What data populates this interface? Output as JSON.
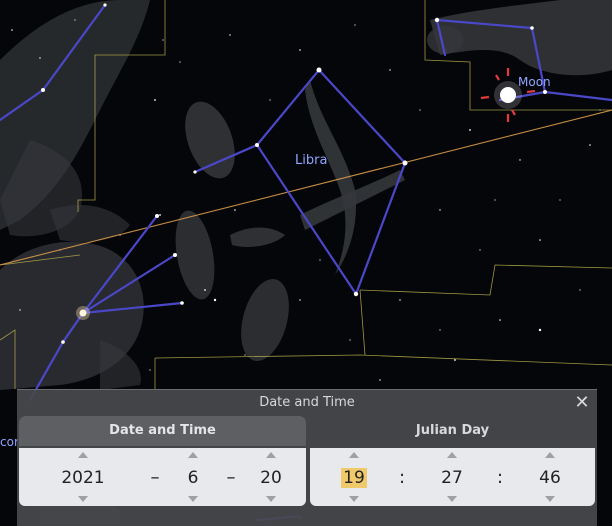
{
  "sky": {
    "constellation_label": "Libra",
    "moon_label": "Moon",
    "scorpius_label": "corpius"
  },
  "dialog": {
    "title": "Date and Time",
    "close_label": "✕",
    "tabs": {
      "date_label": "Date and Time",
      "jd_label": "Julian Day"
    },
    "date": {
      "year": "2021",
      "month": "6",
      "day": "20",
      "separator": "–"
    },
    "time": {
      "hour": "19",
      "minute": "27",
      "second": "46",
      "separator": ":"
    }
  },
  "colors": {
    "constellation_line": "#4a48c8",
    "boundary": "#b9b14a",
    "ecliptic": "#d89a4a",
    "label": "#8ea6ff",
    "highlight": "#f0c96a"
  }
}
